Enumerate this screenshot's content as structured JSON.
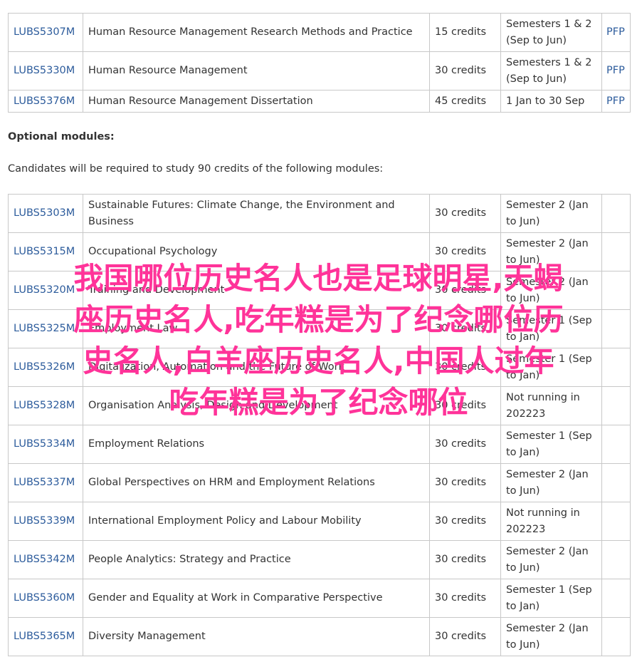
{
  "core_modules": [
    {
      "code": "LUBS5307M",
      "title": "Human Resource Management Research Methods and Practice",
      "credits": "15 credits",
      "semester_lines": [
        "Semesters 1 & 2",
        "(Sep to Jun)"
      ],
      "pfp": "PFP"
    },
    {
      "code": "LUBS5330M",
      "title": "Human Resource Management",
      "credits": "30 credits",
      "semester_lines": [
        "Semesters 1 & 2",
        "(Sep to Jun)"
      ],
      "pfp": "PFP"
    },
    {
      "code": "LUBS5376M",
      "title": "Human Resource Management Dissertation",
      "credits": "45 credits",
      "semester_lines": [
        "1 Jan to 30 Sep"
      ],
      "pfp": "PFP"
    }
  ],
  "optional_heading": "Optional modules:",
  "optional_intro": "Candidates will be required to study 90 credits of the following modules:",
  "optional_modules": [
    {
      "code": "LUBS5303M",
      "title_lines": [
        "Sustainable Futures: Climate Change, the Environment and",
        "Business"
      ],
      "credits": "30 credits",
      "semester_lines": [
        "Semester 2 (Jan",
        "to Jun)"
      ]
    },
    {
      "code": "LUBS5315M",
      "title_lines": [
        "Occupational Psychology"
      ],
      "credits": "30 credits",
      "semester_lines": [
        "Semester 2 (Jan",
        "to Jun)"
      ]
    },
    {
      "code": "LUBS5320M",
      "title_lines": [
        "Training and Development"
      ],
      "credits": "30 credits",
      "semester_lines": [
        "Semester 2 (Jan",
        "to Jun)"
      ]
    },
    {
      "code": "LUBS5325M",
      "title_lines": [
        "Employment Law"
      ],
      "credits": "30 credits",
      "semester_lines": [
        "Semester 1 (Sep",
        "to Jan)"
      ]
    },
    {
      "code": "LUBS5326M",
      "title_lines": [
        "Digitalization, Automation and the Future of Work"
      ],
      "credits": "30 credits",
      "semester_lines": [
        "Semester 1 (Sep",
        "to Jan)"
      ]
    },
    {
      "code": "LUBS5328M",
      "title_lines": [
        "Organisation Analysis, Design and Development"
      ],
      "credits": "30 credits",
      "semester_lines": [
        "Not running in",
        "202223"
      ]
    },
    {
      "code": "LUBS5334M",
      "title_lines": [
        "Employment Relations"
      ],
      "credits": "30 credits",
      "semester_lines": [
        "Semester 1 (Sep",
        "to Jan)"
      ]
    },
    {
      "code": "LUBS5337M",
      "title_lines": [
        "Global Perspectives on HRM and Employment Relations"
      ],
      "credits": "30 credits",
      "semester_lines": [
        "Semester 2 (Jan",
        "to Jun)"
      ]
    },
    {
      "code": "LUBS5339M",
      "title_lines": [
        "International Employment Policy and Labour Mobility"
      ],
      "credits": "30 credits",
      "semester_lines": [
        "Not running in",
        "202223"
      ]
    },
    {
      "code": "LUBS5342M",
      "title_lines": [
        "People Analytics: Strategy and Practice"
      ],
      "credits": "30 credits",
      "semester_lines": [
        "Semester 2 (Jan",
        "to Jun)"
      ]
    },
    {
      "code": "LUBS5360M",
      "title_lines": [
        "Gender and Equality at Work in Comparative Perspective"
      ],
      "credits": "30 credits",
      "semester_lines": [
        "Semester 1 (Sep",
        "to Jan)"
      ]
    },
    {
      "code": "LUBS5365M",
      "title_lines": [
        "Diversity Management"
      ],
      "credits": "30 credits",
      "semester_lines": [
        "Semester 2 (Jan",
        "to Jun)"
      ]
    }
  ],
  "overlay": {
    "lines": [
      "我国哪位历史名人也是足球明星,天蝎",
      "座历史名人,吃年糕是为了纪念哪位历",
      "史名人,白羊座历史名人,中国人过年",
      "吃年糕是为了纪念哪位"
    ],
    "color": "#ff3399"
  },
  "colors": {
    "link": "#2d5c9c",
    "border": "#c8c8c8",
    "text": "#333333"
  }
}
